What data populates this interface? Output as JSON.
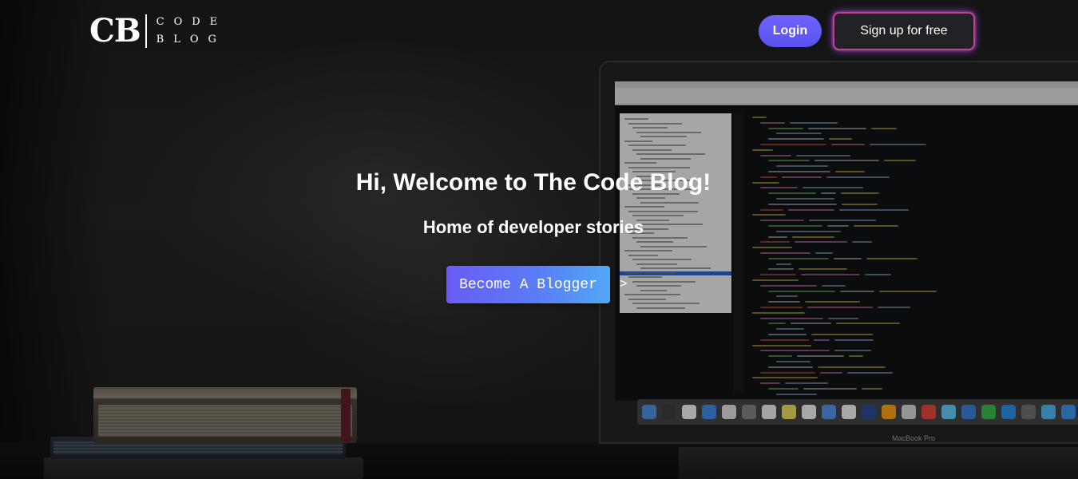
{
  "header": {
    "logo": {
      "mark": "CB",
      "line1": "CODE",
      "line2": "BLOG"
    },
    "login_label": "Login",
    "signup_label": "Sign up for free"
  },
  "hero": {
    "title": "Hi, Welcome to The Code Blog!",
    "subtitle": "Home of developer stories",
    "cta_label": "Become A Blogger",
    "cta_arrow": ">"
  },
  "background": {
    "laptop_brand": "MacBook Pro"
  },
  "colors": {
    "login_bg": "#6e63ff",
    "signup_border": "#c1418f",
    "signup_glow": "#9646dc",
    "cta_start": "#6a5cf5",
    "cta_end": "#52a8f6"
  }
}
